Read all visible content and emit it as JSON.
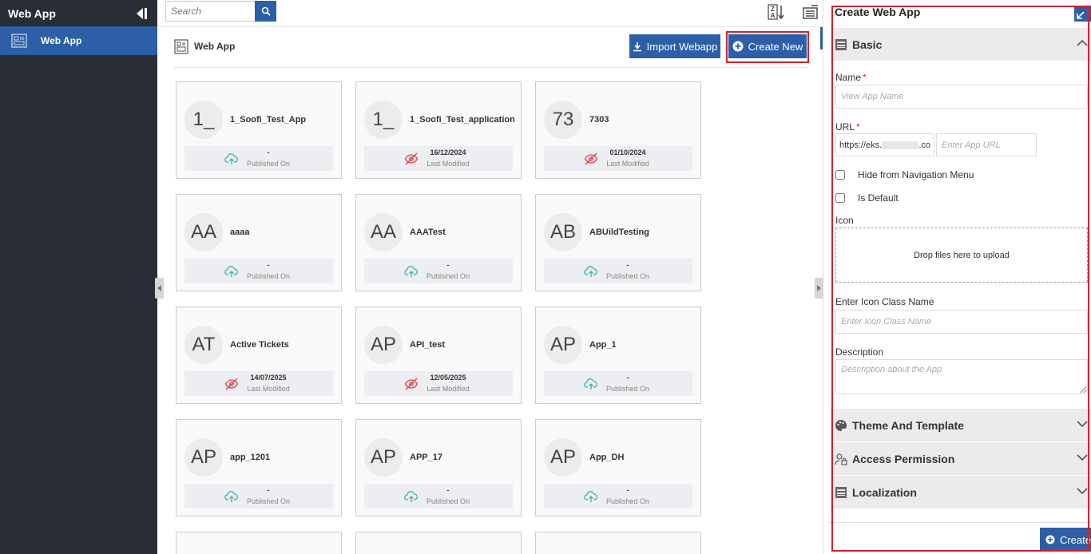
{
  "sidebar": {
    "title": "Web App",
    "items": [
      {
        "label": "Web App",
        "icon": "web-app-icon"
      }
    ]
  },
  "toolbar": {
    "search_placeholder": "Search",
    "sort_icon": "sort-az-icon",
    "view_icon": "list-view-icon"
  },
  "main": {
    "page_title": "Web App",
    "import_label": "Import Webapp",
    "create_new_label": "Create New",
    "apps": [
      {
        "initials": "1_",
        "name": "1_Soofi_Test_App",
        "date": "-",
        "status": "Published On",
        "published": true
      },
      {
        "initials": "1_",
        "name": "1_Soofi_Test_application",
        "date": "16/12/2024",
        "status": "Last Modified",
        "published": false
      },
      {
        "initials": "73",
        "name": "7303",
        "date": "01/10/2024",
        "status": "Last Modified",
        "published": false
      },
      {
        "initials": "AA",
        "name": "aaaa",
        "date": "-",
        "status": "Published On",
        "published": true
      },
      {
        "initials": "AA",
        "name": "AAATest",
        "date": "-",
        "status": "Published On",
        "published": true
      },
      {
        "initials": "AB",
        "name": "ABUildTesting",
        "date": "-",
        "status": "Published On",
        "published": true
      },
      {
        "initials": "AT",
        "name": "Active Tickets",
        "date": "14/07/2025",
        "status": "Last Modified",
        "published": false
      },
      {
        "initials": "AP",
        "name": "API_test",
        "date": "12/05/2025",
        "status": "Last Modified",
        "published": false
      },
      {
        "initials": "AP",
        "name": "App_1",
        "date": "-",
        "status": "Published On",
        "published": true
      },
      {
        "initials": "AP",
        "name": "app_1201",
        "date": "-",
        "status": "Published On",
        "published": true
      },
      {
        "initials": "AP",
        "name": "APP_17",
        "date": "-",
        "status": "Published On",
        "published": true
      },
      {
        "initials": "AP",
        "name": "App_DH",
        "date": "-",
        "status": "Published On",
        "published": true
      }
    ]
  },
  "panel": {
    "title": "Create Web App",
    "sections": {
      "basic": "Basic",
      "theme": "Theme And Template",
      "access": "Access Permission",
      "localization": "Localization"
    },
    "name_label": "Name",
    "name_placeholder": "View App Name",
    "url_label": "URL",
    "url_prefix_a": "https://eks.",
    "url_prefix_b": ".co",
    "url_placeholder": "Enter App URL",
    "hide_nav_label": "Hide from Navigation Menu",
    "is_default_label": "Is Default",
    "icon_label": "Icon",
    "dropzone_text": "Drop files here to upload",
    "icon_class_label": "Enter Icon Class Name",
    "icon_class_placeholder": "Enter Icon Class Name",
    "description_label": "Description",
    "description_placeholder": "Description about the App",
    "create_label": "Create"
  },
  "colors": {
    "primary": "#2c5fa8",
    "sidebar_bg": "#2b2d36",
    "highlight": "#d0222b",
    "published_icon": "#3bb3a3",
    "unpublished_icon": "#e0404a"
  }
}
